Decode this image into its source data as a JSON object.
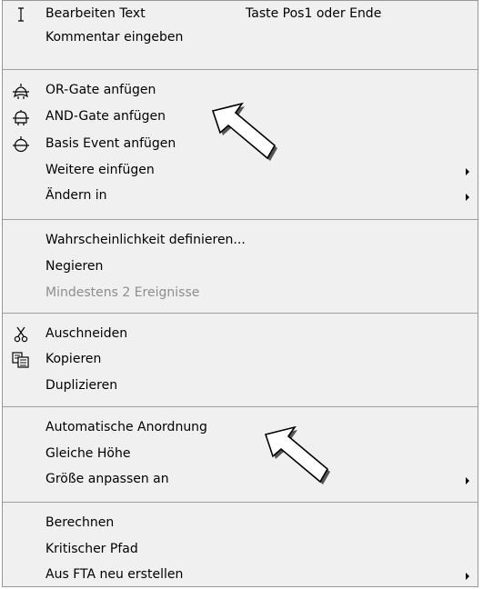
{
  "menu": {
    "items": [
      {
        "label": "Bearbeiten Text",
        "shortcut": "Taste Pos1 oder Ende",
        "icon": "text-cursor-icon"
      },
      {
        "label": "Kommentar eingeben"
      },
      {
        "label": "OR-Gate anfügen",
        "icon": "or-gate-icon"
      },
      {
        "label": "AND-Gate anfügen",
        "icon": "and-gate-icon"
      },
      {
        "label": "Basis Event anfügen",
        "icon": "basis-event-icon"
      },
      {
        "label": "Weitere einfügen",
        "submenu": true
      },
      {
        "label": "Ändern in",
        "submenu": true
      },
      {
        "label": "Wahrscheinlichkeit definieren..."
      },
      {
        "label": "Negieren"
      },
      {
        "label": "Mindestens 2 Ereignisse",
        "disabled": true
      },
      {
        "label": "Auschneiden",
        "icon": "scissors-icon"
      },
      {
        "label": "Kopieren",
        "icon": "copy-icon"
      },
      {
        "label": "Duplizieren"
      },
      {
        "label": "Automatische Anordnung"
      },
      {
        "label": "Gleiche Höhe"
      },
      {
        "label": "Größe anpassen an",
        "submenu": true
      },
      {
        "label": "Berechnen"
      },
      {
        "label": "Kritischer Pfad"
      },
      {
        "label": "Aus FTA neu erstellen",
        "submenu": true
      }
    ]
  },
  "colors": {
    "menu_background": "#f0f0f0",
    "disabled_text": "#8d8d8d",
    "separator": "#a0a0a0",
    "callout_arrow_fill": "#ffffff"
  }
}
